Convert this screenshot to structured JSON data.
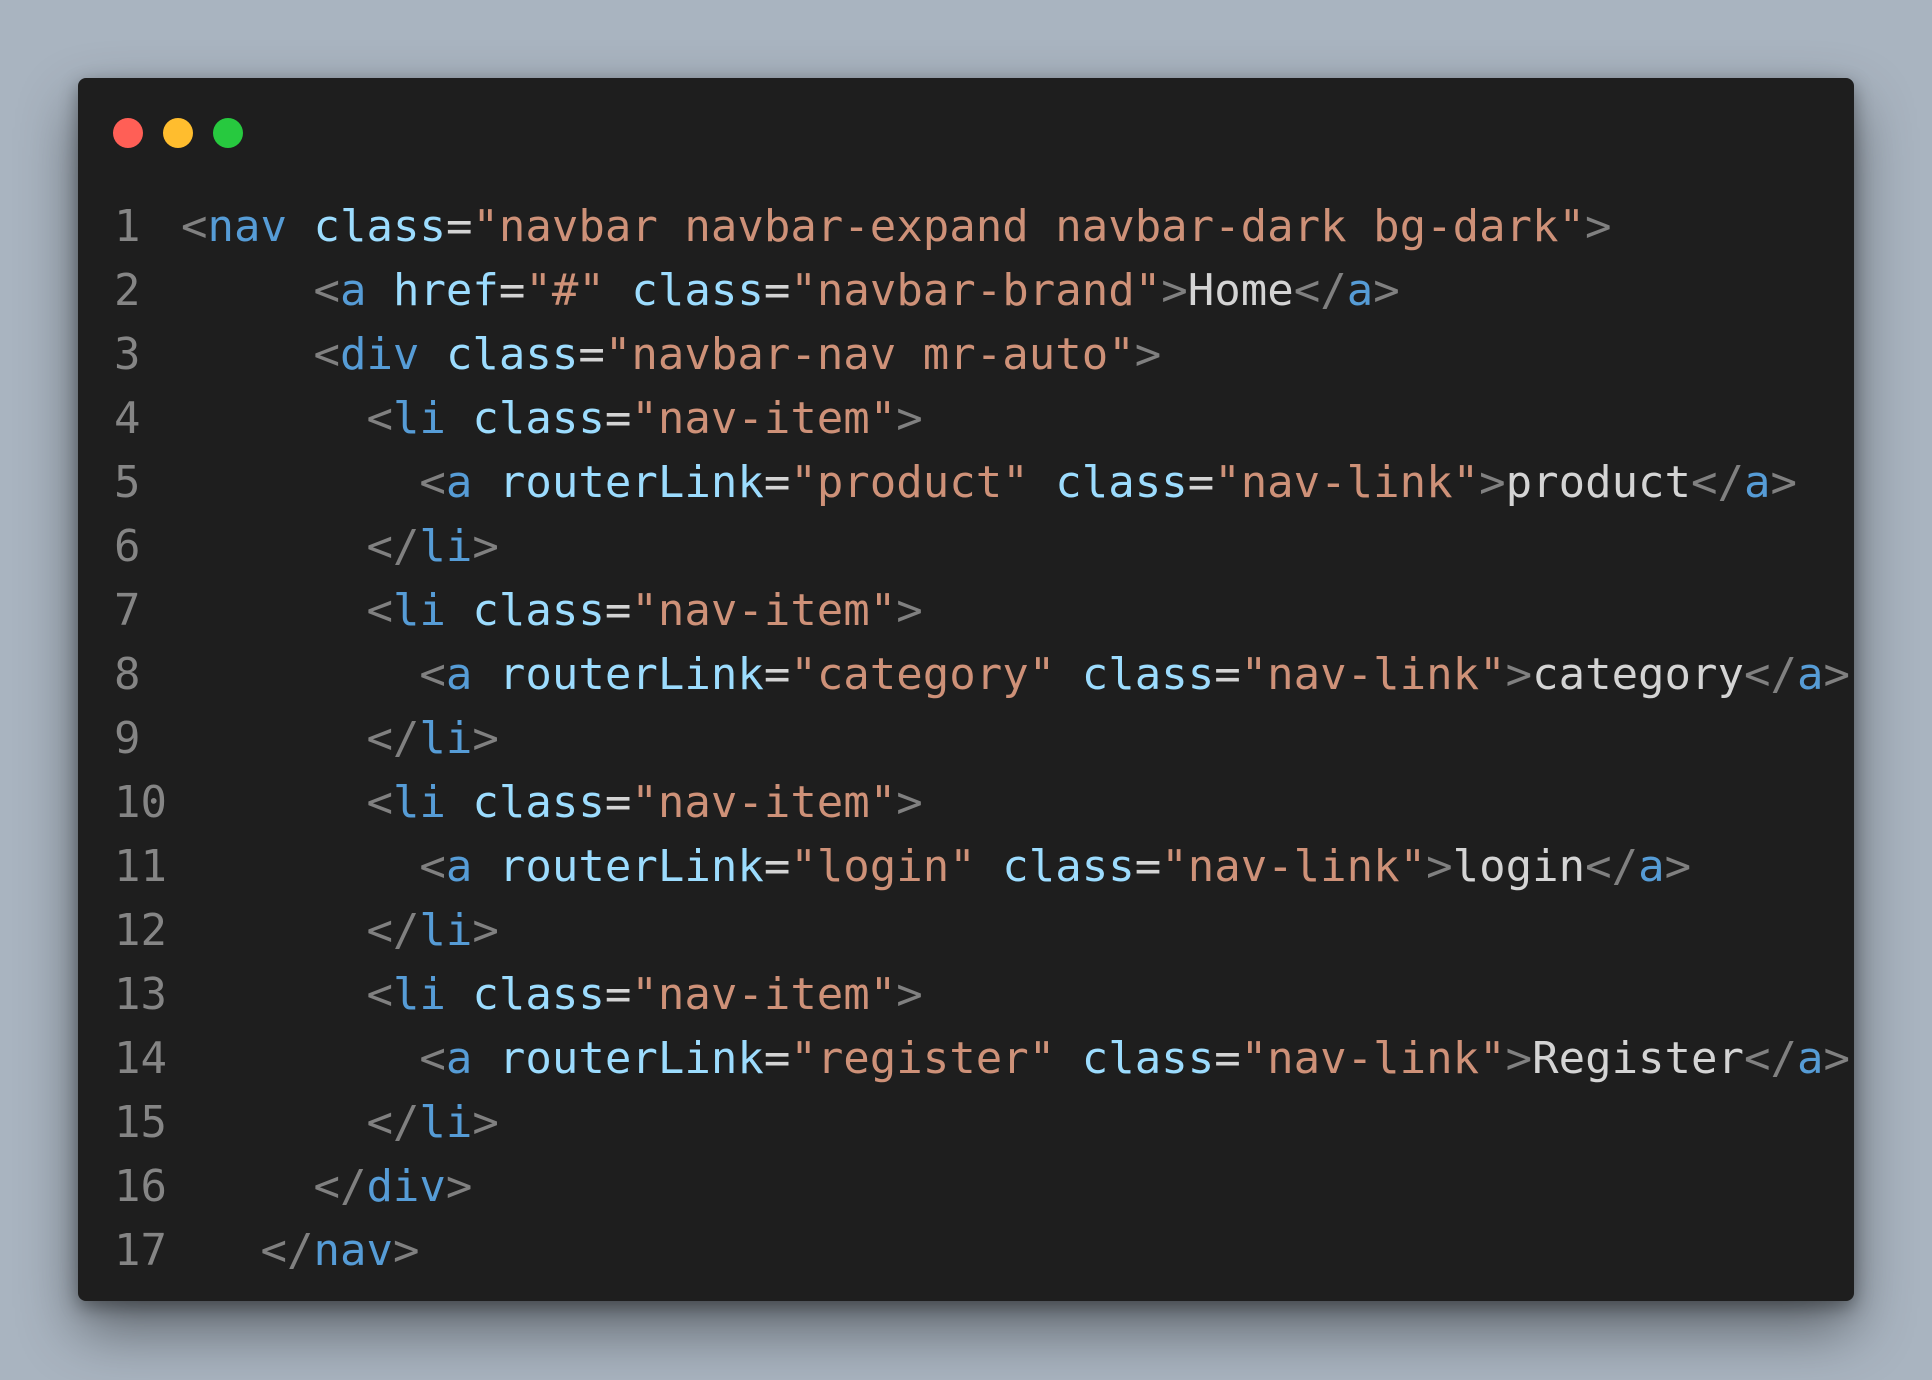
{
  "window": {
    "traffic_lights": [
      {
        "name": "close",
        "color": "#ff5f56"
      },
      {
        "name": "minimize",
        "color": "#ffbd2e"
      },
      {
        "name": "maximize",
        "color": "#27c93f"
      }
    ]
  },
  "colors": {
    "background": "#a9b4c0",
    "editor": "#1e1e1e",
    "line_number": "#858585",
    "punctuation": "#808080",
    "tag": "#569cd6",
    "attribute": "#9cdcfe",
    "string": "#ce9178",
    "text": "#d4d4d4"
  },
  "code": {
    "language": "html",
    "lines": [
      {
        "number": "1",
        "indent": "",
        "tokens": [
          {
            "t": "punct",
            "v": "<"
          },
          {
            "t": "tag",
            "v": "nav"
          },
          {
            "t": "text",
            "v": " "
          },
          {
            "t": "attr",
            "v": "class"
          },
          {
            "t": "eq",
            "v": "="
          },
          {
            "t": "str",
            "v": "\"navbar navbar-expand navbar-dark bg-dark\""
          },
          {
            "t": "punct",
            "v": ">"
          }
        ]
      },
      {
        "number": "2",
        "indent": "     ",
        "tokens": [
          {
            "t": "punct",
            "v": "<"
          },
          {
            "t": "tag",
            "v": "a"
          },
          {
            "t": "text",
            "v": " "
          },
          {
            "t": "attr",
            "v": "href"
          },
          {
            "t": "eq",
            "v": "="
          },
          {
            "t": "str",
            "v": "\"#\""
          },
          {
            "t": "text",
            "v": " "
          },
          {
            "t": "attr",
            "v": "class"
          },
          {
            "t": "eq",
            "v": "="
          },
          {
            "t": "str",
            "v": "\"navbar-brand\""
          },
          {
            "t": "punct",
            "v": ">"
          },
          {
            "t": "text",
            "v": "Home"
          },
          {
            "t": "punct",
            "v": "</"
          },
          {
            "t": "tag",
            "v": "a"
          },
          {
            "t": "punct",
            "v": ">"
          }
        ]
      },
      {
        "number": "3",
        "indent": "     ",
        "tokens": [
          {
            "t": "punct",
            "v": "<"
          },
          {
            "t": "tag",
            "v": "div"
          },
          {
            "t": "text",
            "v": " "
          },
          {
            "t": "attr",
            "v": "class"
          },
          {
            "t": "eq",
            "v": "="
          },
          {
            "t": "str",
            "v": "\"navbar-nav mr-auto\""
          },
          {
            "t": "punct",
            "v": ">"
          }
        ]
      },
      {
        "number": "4",
        "indent": "       ",
        "tokens": [
          {
            "t": "punct",
            "v": "<"
          },
          {
            "t": "tag",
            "v": "li"
          },
          {
            "t": "text",
            "v": " "
          },
          {
            "t": "attr",
            "v": "class"
          },
          {
            "t": "eq",
            "v": "="
          },
          {
            "t": "str",
            "v": "\"nav-item\""
          },
          {
            "t": "punct",
            "v": ">"
          }
        ]
      },
      {
        "number": "5",
        "indent": "         ",
        "tokens": [
          {
            "t": "punct",
            "v": "<"
          },
          {
            "t": "tag",
            "v": "a"
          },
          {
            "t": "text",
            "v": " "
          },
          {
            "t": "attr",
            "v": "routerLink"
          },
          {
            "t": "eq",
            "v": "="
          },
          {
            "t": "str",
            "v": "\"product\""
          },
          {
            "t": "text",
            "v": " "
          },
          {
            "t": "attr",
            "v": "class"
          },
          {
            "t": "eq",
            "v": "="
          },
          {
            "t": "str",
            "v": "\"nav-link\""
          },
          {
            "t": "punct",
            "v": ">"
          },
          {
            "t": "text",
            "v": "product"
          },
          {
            "t": "punct",
            "v": "</"
          },
          {
            "t": "tag",
            "v": "a"
          },
          {
            "t": "punct",
            "v": ">"
          }
        ]
      },
      {
        "number": "6",
        "indent": "       ",
        "tokens": [
          {
            "t": "punct",
            "v": "</"
          },
          {
            "t": "tag",
            "v": "li"
          },
          {
            "t": "punct",
            "v": ">"
          }
        ]
      },
      {
        "number": "7",
        "indent": "       ",
        "tokens": [
          {
            "t": "punct",
            "v": "<"
          },
          {
            "t": "tag",
            "v": "li"
          },
          {
            "t": "text",
            "v": " "
          },
          {
            "t": "attr",
            "v": "class"
          },
          {
            "t": "eq",
            "v": "="
          },
          {
            "t": "str",
            "v": "\"nav-item\""
          },
          {
            "t": "punct",
            "v": ">"
          }
        ]
      },
      {
        "number": "8",
        "indent": "         ",
        "tokens": [
          {
            "t": "punct",
            "v": "<"
          },
          {
            "t": "tag",
            "v": "a"
          },
          {
            "t": "text",
            "v": " "
          },
          {
            "t": "attr",
            "v": "routerLink"
          },
          {
            "t": "eq",
            "v": "="
          },
          {
            "t": "str",
            "v": "\"category\""
          },
          {
            "t": "text",
            "v": " "
          },
          {
            "t": "attr",
            "v": "class"
          },
          {
            "t": "eq",
            "v": "="
          },
          {
            "t": "str",
            "v": "\"nav-link\""
          },
          {
            "t": "punct",
            "v": ">"
          },
          {
            "t": "text",
            "v": "category"
          },
          {
            "t": "punct",
            "v": "</"
          },
          {
            "t": "tag",
            "v": "a"
          },
          {
            "t": "punct",
            "v": ">"
          }
        ]
      },
      {
        "number": "9",
        "indent": "       ",
        "tokens": [
          {
            "t": "punct",
            "v": "</"
          },
          {
            "t": "tag",
            "v": "li"
          },
          {
            "t": "punct",
            "v": ">"
          }
        ]
      },
      {
        "number": "10",
        "indent": "       ",
        "tokens": [
          {
            "t": "punct",
            "v": "<"
          },
          {
            "t": "tag",
            "v": "li"
          },
          {
            "t": "text",
            "v": " "
          },
          {
            "t": "attr",
            "v": "class"
          },
          {
            "t": "eq",
            "v": "="
          },
          {
            "t": "str",
            "v": "\"nav-item\""
          },
          {
            "t": "punct",
            "v": ">"
          }
        ]
      },
      {
        "number": "11",
        "indent": "         ",
        "tokens": [
          {
            "t": "punct",
            "v": "<"
          },
          {
            "t": "tag",
            "v": "a"
          },
          {
            "t": "text",
            "v": " "
          },
          {
            "t": "attr",
            "v": "routerLink"
          },
          {
            "t": "eq",
            "v": "="
          },
          {
            "t": "str",
            "v": "\"login\""
          },
          {
            "t": "text",
            "v": " "
          },
          {
            "t": "attr",
            "v": "class"
          },
          {
            "t": "eq",
            "v": "="
          },
          {
            "t": "str",
            "v": "\"nav-link\""
          },
          {
            "t": "punct",
            "v": ">"
          },
          {
            "t": "text",
            "v": "login"
          },
          {
            "t": "punct",
            "v": "</"
          },
          {
            "t": "tag",
            "v": "a"
          },
          {
            "t": "punct",
            "v": ">"
          }
        ]
      },
      {
        "number": "12",
        "indent": "       ",
        "tokens": [
          {
            "t": "punct",
            "v": "</"
          },
          {
            "t": "tag",
            "v": "li"
          },
          {
            "t": "punct",
            "v": ">"
          }
        ]
      },
      {
        "number": "13",
        "indent": "       ",
        "tokens": [
          {
            "t": "punct",
            "v": "<"
          },
          {
            "t": "tag",
            "v": "li"
          },
          {
            "t": "text",
            "v": " "
          },
          {
            "t": "attr",
            "v": "class"
          },
          {
            "t": "eq",
            "v": "="
          },
          {
            "t": "str",
            "v": "\"nav-item\""
          },
          {
            "t": "punct",
            "v": ">"
          }
        ]
      },
      {
        "number": "14",
        "indent": "         ",
        "tokens": [
          {
            "t": "punct",
            "v": "<"
          },
          {
            "t": "tag",
            "v": "a"
          },
          {
            "t": "text",
            "v": " "
          },
          {
            "t": "attr",
            "v": "routerLink"
          },
          {
            "t": "eq",
            "v": "="
          },
          {
            "t": "str",
            "v": "\"register\""
          },
          {
            "t": "text",
            "v": " "
          },
          {
            "t": "attr",
            "v": "class"
          },
          {
            "t": "eq",
            "v": "="
          },
          {
            "t": "str",
            "v": "\"nav-link\""
          },
          {
            "t": "punct",
            "v": ">"
          },
          {
            "t": "text",
            "v": "Register"
          },
          {
            "t": "punct",
            "v": "</"
          },
          {
            "t": "tag",
            "v": "a"
          },
          {
            "t": "punct",
            "v": ">"
          }
        ]
      },
      {
        "number": "15",
        "indent": "       ",
        "tokens": [
          {
            "t": "punct",
            "v": "</"
          },
          {
            "t": "tag",
            "v": "li"
          },
          {
            "t": "punct",
            "v": ">"
          }
        ]
      },
      {
        "number": "16",
        "indent": "     ",
        "tokens": [
          {
            "t": "punct",
            "v": "</"
          },
          {
            "t": "tag",
            "v": "div"
          },
          {
            "t": "punct",
            "v": ">"
          }
        ]
      },
      {
        "number": "17",
        "indent": "   ",
        "tokens": [
          {
            "t": "punct",
            "v": "</"
          },
          {
            "t": "tag",
            "v": "nav"
          },
          {
            "t": "punct",
            "v": ">"
          }
        ]
      }
    ]
  }
}
